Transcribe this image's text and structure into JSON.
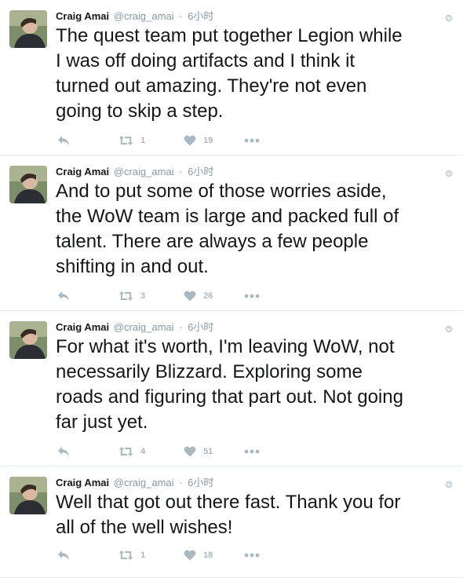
{
  "tweets": [
    {
      "author": {
        "name": "Craig Amai",
        "handle": "@craig_amai"
      },
      "dot": "·",
      "time": "6小时",
      "text": "The quest team put together Legion while\nI was off doing artifacts and I think it\nturned out amazing. They're not even\ngoing to skip a step.",
      "retweets": "1",
      "likes": "19"
    },
    {
      "author": {
        "name": "Craig Amai",
        "handle": "@craig_amai"
      },
      "dot": "·",
      "time": "6小时",
      "text": "And to put some of those worries aside,\nthe WoW team is large and packed full of\ntalent. There are always a few people\nshifting in and out.",
      "retweets": "3",
      "likes": "26"
    },
    {
      "author": {
        "name": "Craig Amai",
        "handle": "@craig_amai"
      },
      "dot": "·",
      "time": "6小时",
      "text": "For what it's worth, I'm leaving WoW, not\nnecessarily Blizzard. Exploring some\nroads and figuring that part out. Not going\nfar just yet.",
      "retweets": "4",
      "likes": "51"
    },
    {
      "author": {
        "name": "Craig Amai",
        "handle": "@craig_amai"
      },
      "dot": "·",
      "time": "6小时",
      "text": "Well that got out there fast. Thank you for\nall of the well wishes!",
      "retweets": "1",
      "likes": "18"
    }
  ],
  "icons": {
    "reply": "reply-icon",
    "retweet": "retweet-icon",
    "like": "heart-icon",
    "more": "more-icon",
    "caret": "caret-down-icon"
  },
  "colors": {
    "text": "#14171a",
    "muted": "#8899a6",
    "action": "#aab8c2",
    "divider": "#e6ecf0"
  }
}
